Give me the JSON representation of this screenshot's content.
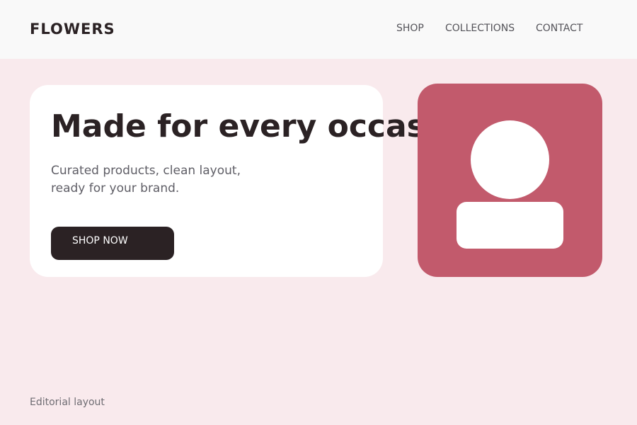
{
  "header": {
    "brand": "FLOWERS",
    "nav": [
      {
        "label": "SHOP"
      },
      {
        "label": "COLLECTIONS"
      },
      {
        "label": "CONTACT"
      }
    ]
  },
  "hero": {
    "title": "Made for every occasion",
    "subtitle_lines": [
      "Curated products, clean layout,",
      "ready for your brand."
    ],
    "cta_label": "SHOP NOW"
  },
  "image_placeholder": {
    "icon": "avatar-placeholder-icon",
    "background_color": "#c25a6c"
  },
  "footer": {
    "note": "Editorial layout"
  },
  "colors": {
    "page_background": "#f9eaed",
    "header_background": "#f9f9f9",
    "text_dark": "#2b2224",
    "accent": "#c25a6c"
  }
}
